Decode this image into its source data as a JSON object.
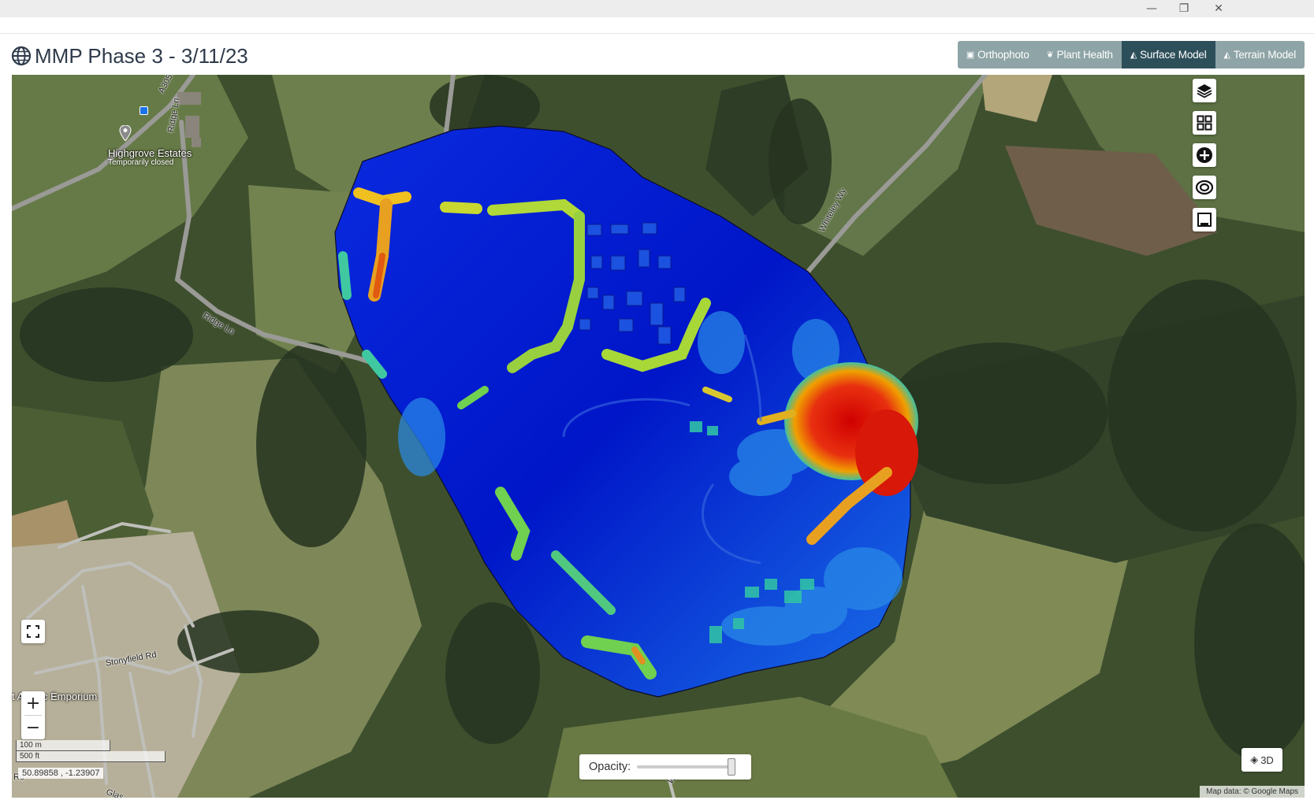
{
  "window": {
    "minimize_glyph": "—",
    "restore_glyph": "❐",
    "close_glyph": "✕"
  },
  "header": {
    "title": "MMP Phase 3 - 3/11/23",
    "icon": "globe-icon"
  },
  "modes": [
    {
      "label": "Orthophoto",
      "icon": "image-icon",
      "active": false
    },
    {
      "label": "Plant Health",
      "icon": "plant-icon",
      "active": false
    },
    {
      "label": "Surface Model",
      "icon": "chart-area-icon",
      "active": true
    },
    {
      "label": "Terrain Model",
      "icon": "chart-area-icon",
      "active": false
    }
  ],
  "map": {
    "places": [
      {
        "name": "Highgrove Estates",
        "sub": "Temporarily closed"
      },
      {
        "name": "t Artistic Emporium"
      }
    ],
    "roads": [
      "A3051",
      "Ridge Ln",
      "Ridge Ln",
      "Whiteley Wy",
      "Stonyfield Rd",
      "Whit",
      "Glas",
      "Rd"
    ],
    "scale": {
      "metric": "100 m",
      "imperial": "500 ft"
    },
    "coords": "50.89858 , -1.23907",
    "attribution": "Map data: © Google Maps",
    "opacity_label": "Opacity:",
    "opacity_value": 1.0,
    "btn_3d": "3D",
    "zoom_in": "+",
    "zoom_out": "−",
    "right_controls": [
      "layers-icon",
      "grid-icon",
      "plus-circle-icon",
      "eye-icon",
      "crop-icon"
    ]
  }
}
